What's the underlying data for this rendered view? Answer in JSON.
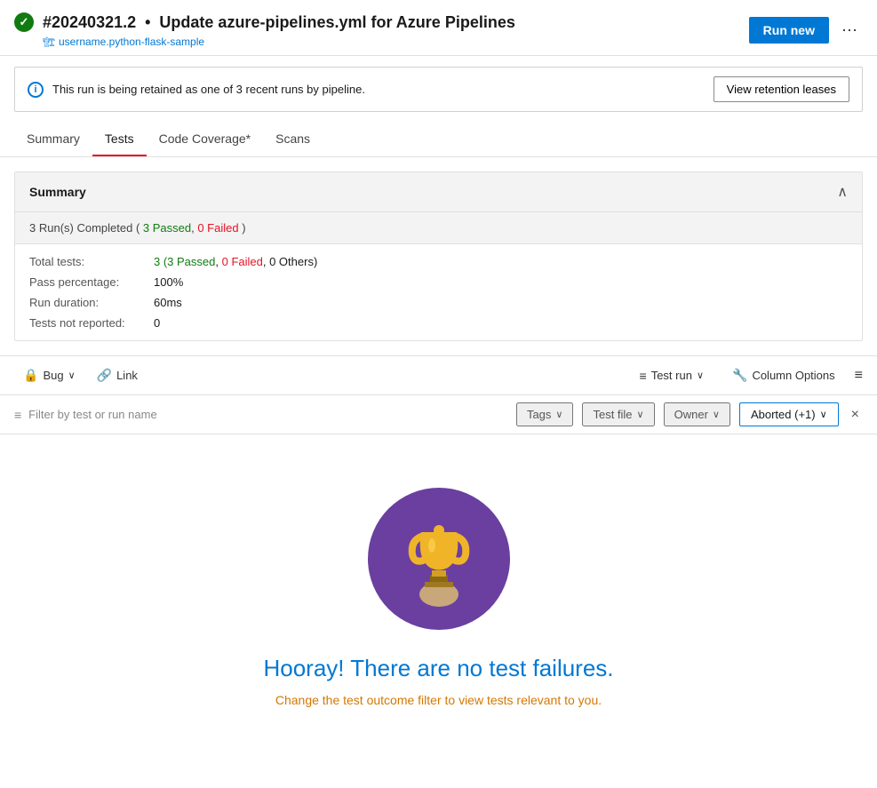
{
  "header": {
    "build_number": "#20240321.2",
    "title": "Update azure-pipelines.yml for Azure Pipelines",
    "subtitle": "username.python-flask-sample",
    "run_new_label": "Run new",
    "more_label": "⋯"
  },
  "retention": {
    "message": "This run is being retained as one of 3 recent runs by pipeline.",
    "button_label": "View retention leases"
  },
  "tabs": [
    {
      "id": "summary",
      "label": "Summary",
      "active": false
    },
    {
      "id": "tests",
      "label": "Tests",
      "active": true
    },
    {
      "id": "coverage",
      "label": "Code Coverage*",
      "active": false
    },
    {
      "id": "scans",
      "label": "Scans",
      "active": false
    }
  ],
  "summary": {
    "title": "Summary",
    "runs_completed_text": "3 Run(s) Completed ( 3 Passed, 0 Failed )",
    "total_tests_label": "Total tests:",
    "total_tests_value": "3 (3 Passed, 0 Failed, 0 Others)",
    "pass_pct_label": "Pass percentage:",
    "pass_pct_value": "100%",
    "run_duration_label": "Run duration:",
    "run_duration_value": "60ms",
    "not_reported_label": "Tests not reported:",
    "not_reported_value": "0"
  },
  "toolbar": {
    "bug_label": "Bug",
    "link_label": "Link",
    "test_run_label": "Test run",
    "column_options_label": "Column Options"
  },
  "filter": {
    "placeholder": "Filter by test or run name",
    "tags_label": "Tags",
    "test_file_label": "Test file",
    "owner_label": "Owner",
    "aborted_label": "Aborted (+1)"
  },
  "empty_state": {
    "title": "Hooray! There are no test failures.",
    "subtitle": "Change the test outcome filter to view tests relevant to you."
  }
}
